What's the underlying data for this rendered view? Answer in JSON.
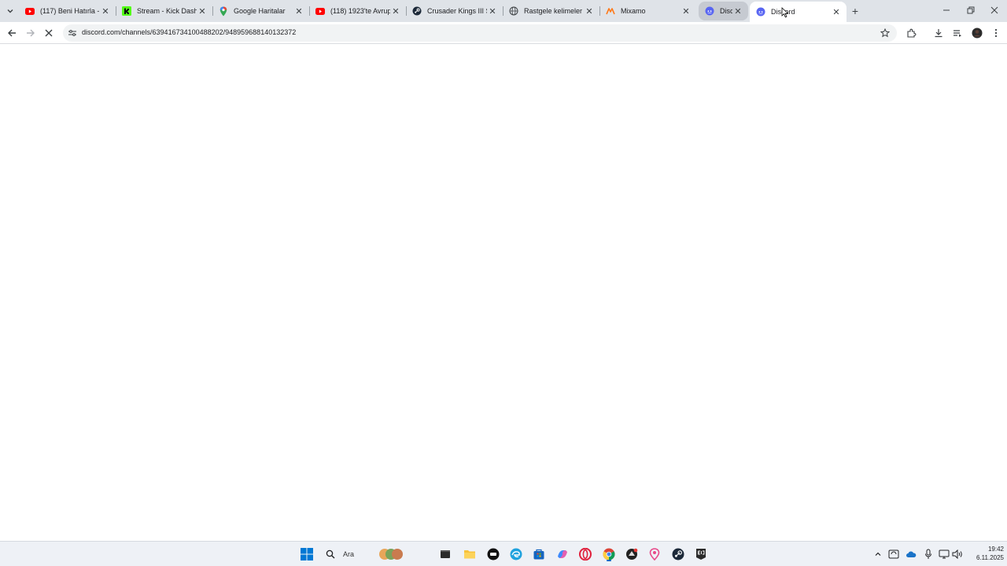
{
  "browser": {
    "tabs": [
      {
        "title": "(117) Beni Hatırla - Yo",
        "favicon": "youtube-icon"
      },
      {
        "title": "Stream - Kick Dashbo",
        "favicon": "kick-icon"
      },
      {
        "title": "Google Haritalar",
        "favicon": "maps-pin-icon"
      },
      {
        "title": "(118) 1923'te Avrupa",
        "favicon": "youtube-icon"
      },
      {
        "title": "Crusader Kings III Ste",
        "favicon": "steam-icon"
      },
      {
        "title": "Rastgele kelimeler de",
        "favicon": "globe-icon"
      },
      {
        "title": "Mixamo",
        "favicon": "mixamo-icon"
      },
      {
        "title": "Disco",
        "favicon": "discord-icon"
      },
      {
        "title": "Discord",
        "favicon": "discord-icon"
      }
    ],
    "address_url": "discord.com/channels/639416734100488202/948959688140132372",
    "colors": {
      "tabstrip": "#dfe3e8",
      "active_tab": "#ffffff",
      "youtube": "#ff0000",
      "kick": "#53fc18",
      "discord": "#5865f2"
    }
  },
  "taskbar": {
    "search_placeholder": "Ara",
    "time": "19:42",
    "date": "6.11.2025"
  }
}
